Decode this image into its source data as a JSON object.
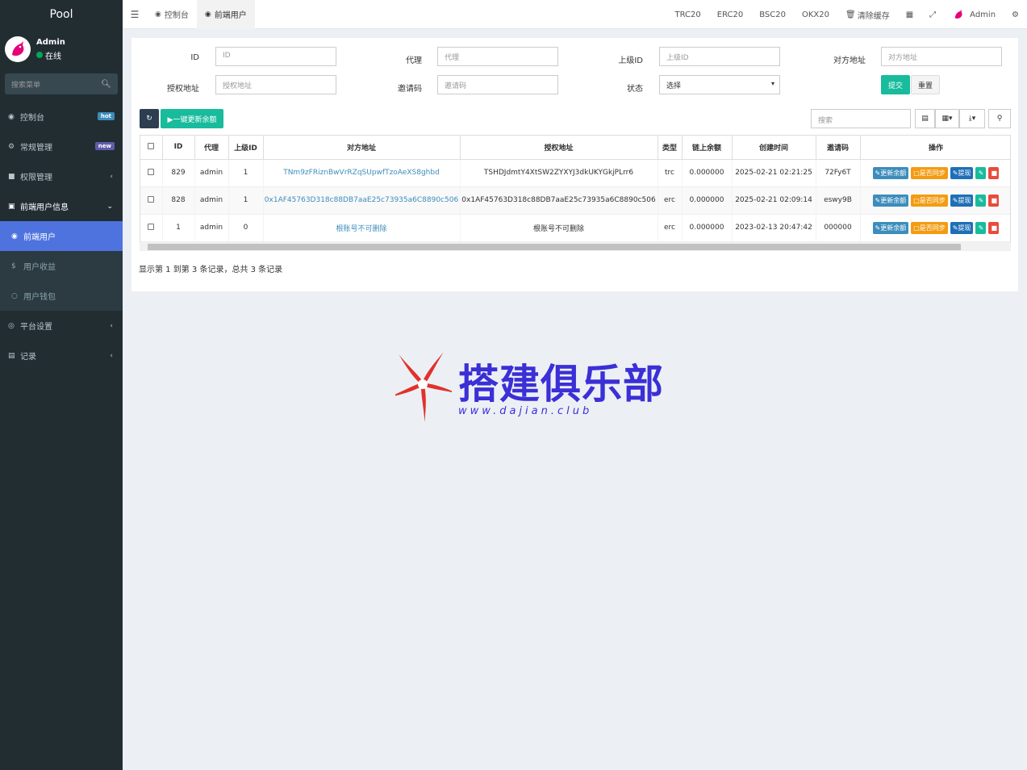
{
  "app": {
    "title": "Pool"
  },
  "user": {
    "name": "Admin",
    "status": "在线"
  },
  "sidebar": {
    "search_placeholder": "搜索菜单",
    "items": [
      {
        "label": "控制台",
        "icon": "dashboard-icon",
        "badge": "hot"
      },
      {
        "label": "常规管理",
        "icon": "cogs-icon",
        "badge": "new"
      },
      {
        "label": "权限管理",
        "icon": "group-icon"
      },
      {
        "label": "前端用户信息",
        "icon": "user-card-icon"
      },
      {
        "label": "前端用户",
        "icon": "user-circle-icon"
      },
      {
        "label": "用户收益",
        "icon": "dollar-icon"
      },
      {
        "label": "用户钱包",
        "icon": "circle-icon"
      },
      {
        "label": "平台设置",
        "icon": "settings-icon"
      },
      {
        "label": "记录",
        "icon": "chart-icon"
      }
    ]
  },
  "topbar": {
    "tabs": [
      {
        "label": "控制台",
        "icon": "dashboard-icon"
      },
      {
        "label": "前端用户",
        "icon": "user-circle-icon"
      }
    ],
    "links": [
      "TRC20",
      "ERC20",
      "BSC20",
      "OKX20"
    ],
    "clear_cache": "清除缓存",
    "user_name": "Admin"
  },
  "filters": {
    "id": {
      "label": "ID",
      "placeholder": "ID"
    },
    "agent": {
      "label": "代理",
      "placeholder": "代理"
    },
    "parent_id": {
      "label": "上级ID",
      "placeholder": "上级ID"
    },
    "target_address": {
      "label": "对方地址",
      "placeholder": "对方地址"
    },
    "auth_address": {
      "label": "授权地址",
      "placeholder": "授权地址"
    },
    "invite_code": {
      "label": "邀请码",
      "placeholder": "邀请码"
    },
    "status": {
      "label": "状态",
      "value": "选择"
    },
    "submit": "提交",
    "reset": "重置"
  },
  "toolbar": {
    "update_all": "▶一键更新余额",
    "search_placeholder": "搜索"
  },
  "table": {
    "headers": [
      "ID",
      "代理",
      "上级ID",
      "对方地址",
      "授权地址",
      "类型",
      "链上余额",
      "创建时间",
      "邀请码",
      "操作"
    ],
    "rows": [
      {
        "id": "829",
        "agent": "admin",
        "parent_id": "1",
        "target": "TNm9zFRiznBwVrRZqSUpwfTzoAeXS8ghbd",
        "auth": "TSHDJdmtY4XtSW2ZYXYJ3dkUKYGkjPLrr6",
        "type": "trc",
        "balance": "0.000000",
        "created": "2025-02-21 02:21:25",
        "code": "72Fy6T"
      },
      {
        "id": "828",
        "agent": "admin",
        "parent_id": "1",
        "target": "0x1AF45763D318c88DB7aaE25c73935a6C8890c506",
        "auth": "0x1AF45763D318c88DB7aaE25c73935a6C8890c506",
        "type": "erc",
        "balance": "0.000000",
        "created": "2025-02-21 02:09:14",
        "code": "eswy9B"
      },
      {
        "id": "1",
        "agent": "admin",
        "parent_id": "0",
        "target": "根账号不可删除",
        "auth": "根账号不可删除",
        "type": "erc",
        "balance": "0.000000",
        "created": "2023-02-13 20:47:42",
        "code": "000000"
      }
    ],
    "actions": {
      "update": "更新余额",
      "sync": "是否同步",
      "withdraw": "提现"
    }
  },
  "pager": {
    "text": "显示第 1 到第 3 条记录，总共 3 条记录"
  },
  "watermark": {
    "title": "搭建俱乐部",
    "url": "www.dajian.club"
  },
  "colors": {
    "sidebar": "#222d32",
    "active": "#4e73df",
    "success": "#18bc9c",
    "primary": "#3c8dbc",
    "warning": "#f39c12",
    "danger": "#e74c3c"
  }
}
